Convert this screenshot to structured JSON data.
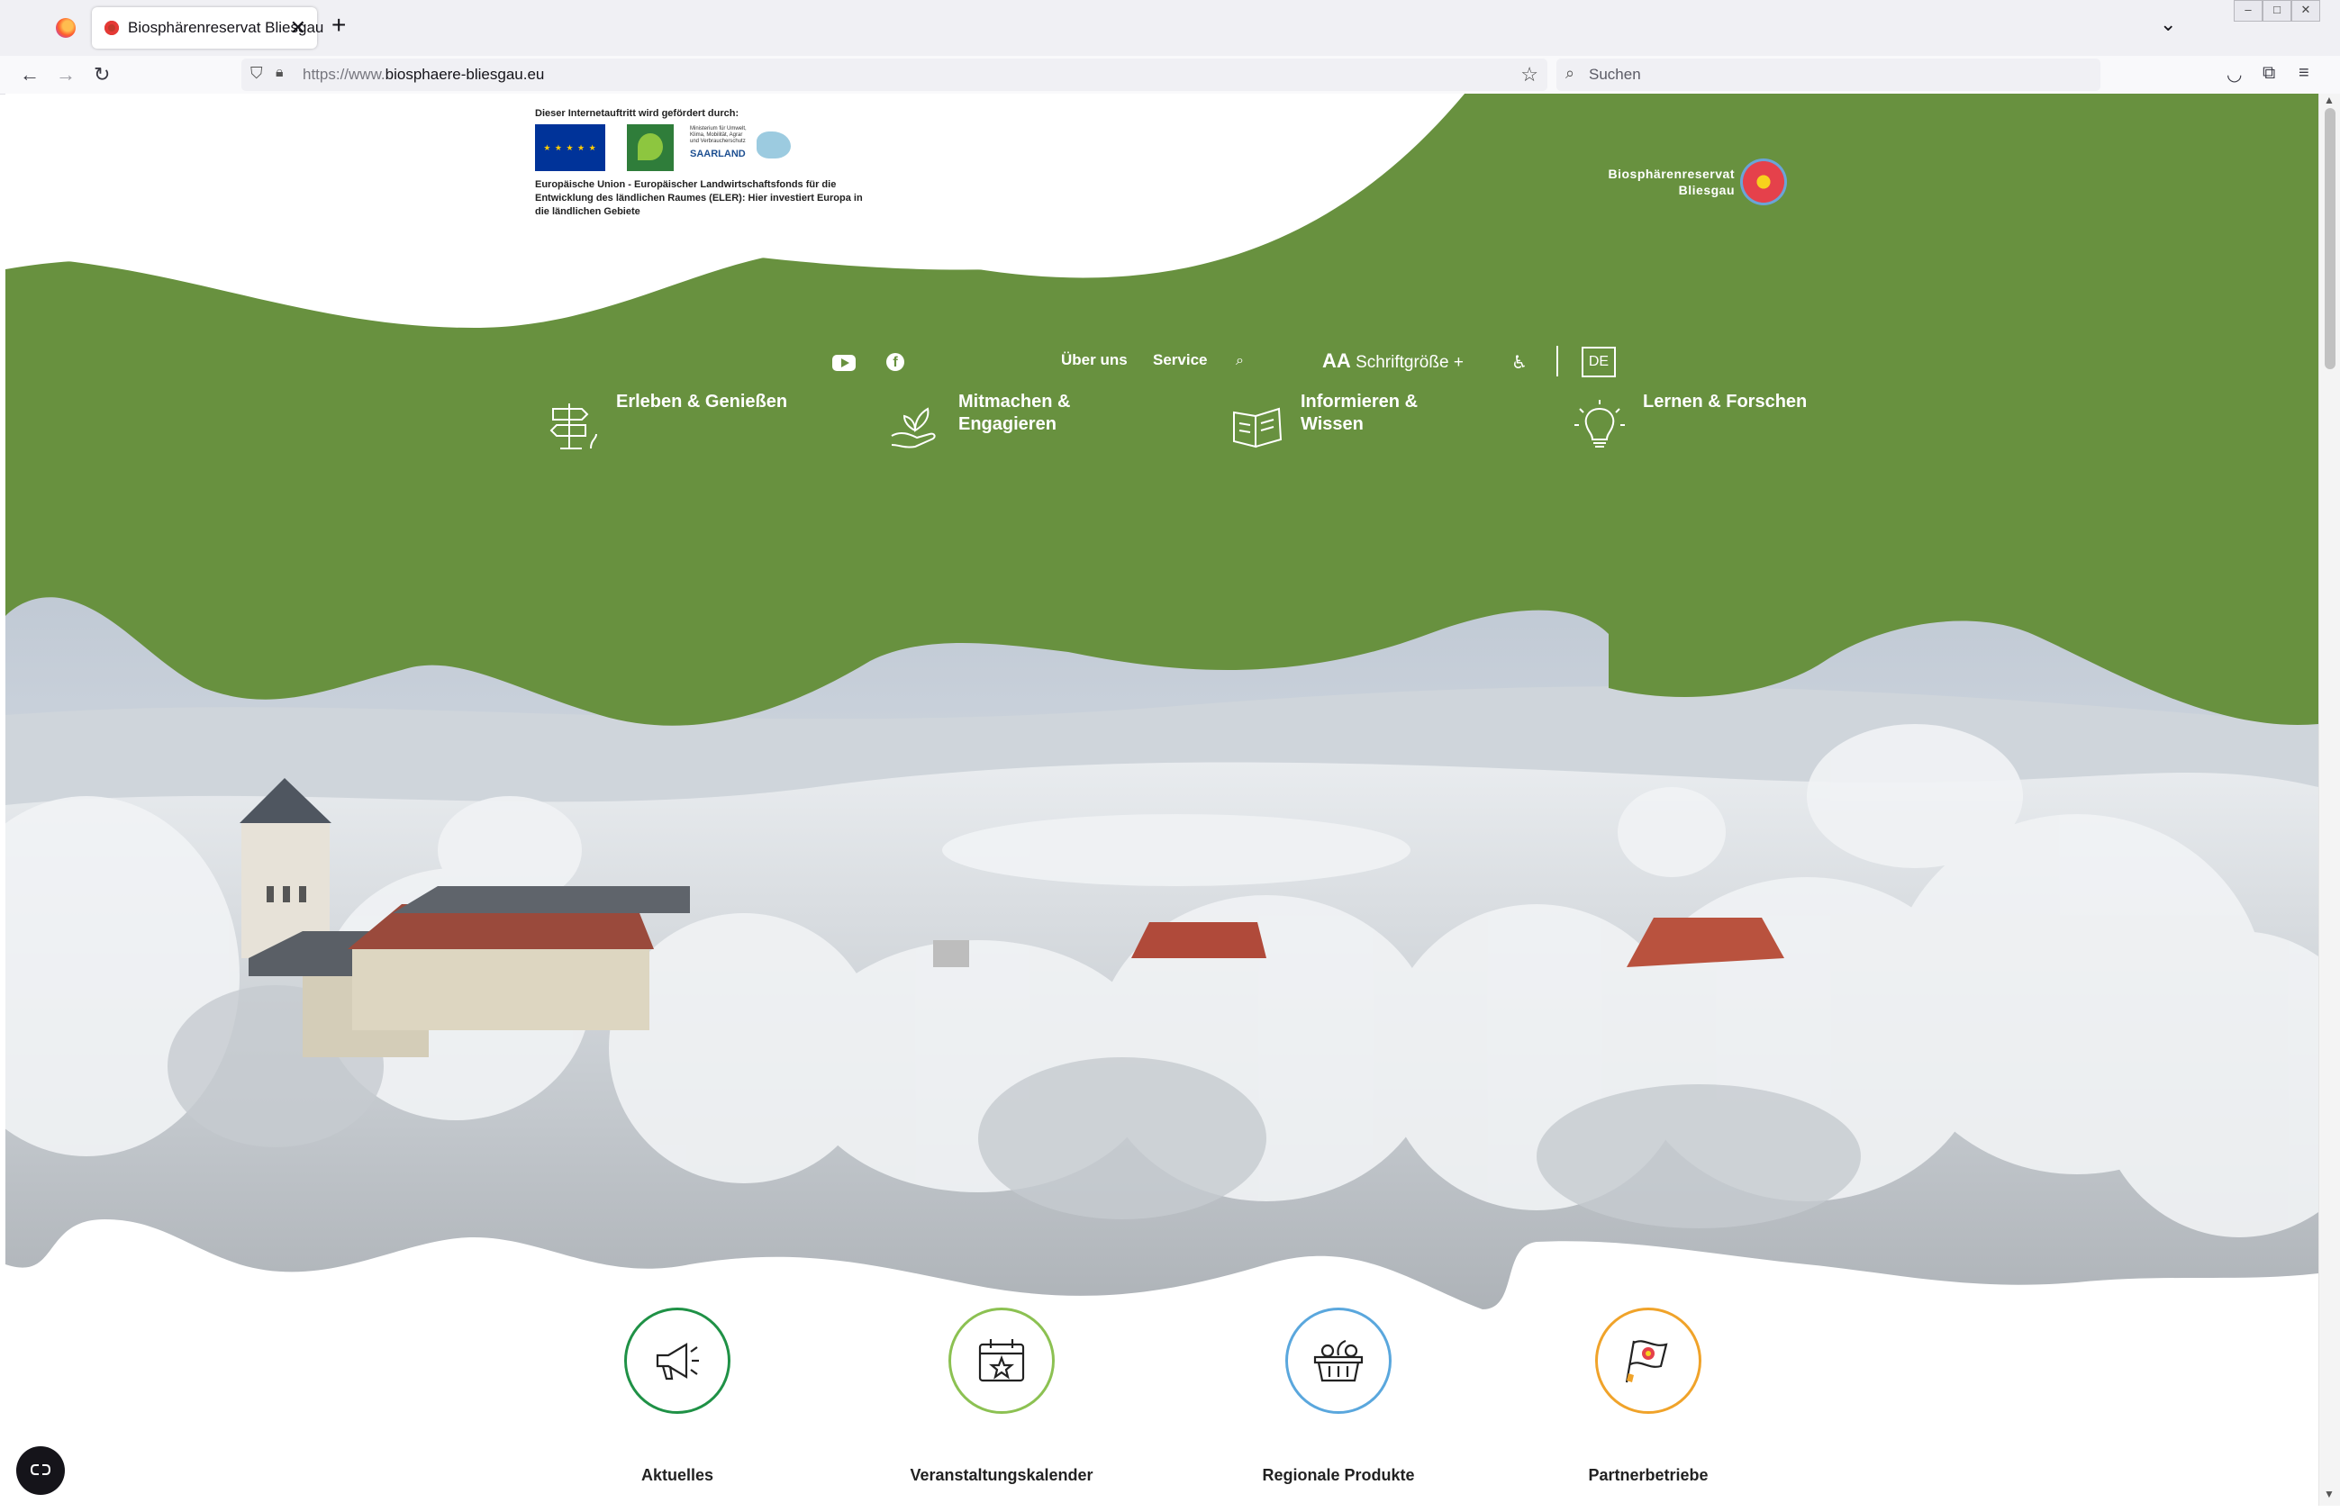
{
  "browser": {
    "tab_title": "Biosphärenreservat Bliesgau",
    "url_prefix": "https://www.",
    "url_domain": "biosphaere-bliesgau.eu",
    "search_placeholder": "Suchen",
    "new_tab_label": "+",
    "close_label": "✕"
  },
  "sponsor": {
    "heading": "Dieser Internetauftritt wird gefördert durch:",
    "text": "Europäische Union - Europäischer Landwirtschaftsfonds für die Entwicklung des ländlichen Raumes (ELER): Hier investiert Europa in die ländlichen Gebiete",
    "saarland_small": "Ministerium für Umwelt, Klima, Mobilität, Agrar und Verbraucherschutz",
    "saarland_name": "SAARLAND"
  },
  "brand": {
    "name": "Biosphärenreservat Bliesgau"
  },
  "topnav": {
    "ueber_uns": "Über uns",
    "service": "Service",
    "font_size_aa": "AA",
    "font_size_label": "Schriftgröße +",
    "language": "DE"
  },
  "mainnav": [
    {
      "label": "Erleben & Genießen",
      "icon": "signpost-icon"
    },
    {
      "label": "Mitmachen & Engagieren",
      "icon": "hand-sprout-icon"
    },
    {
      "label": "Informieren & Wissen",
      "icon": "book-icon"
    },
    {
      "label": "Lernen & Forschen",
      "icon": "lightbulb-icon"
    }
  ],
  "quicklinks": [
    {
      "label": "Aktuelles",
      "icon": "megaphone-icon",
      "color": "#1f9146"
    },
    {
      "label": "Veranstaltungskalender",
      "icon": "calendar-star-icon",
      "color": "#8cc152"
    },
    {
      "label": "Regionale Produkte",
      "icon": "basket-icon",
      "color": "#5aa7dd"
    },
    {
      "label": "Partnerbetriebe",
      "icon": "flag-icon",
      "color": "#f0a32a"
    }
  ],
  "colors": {
    "green": "#68913f",
    "white": "#ffffff"
  }
}
